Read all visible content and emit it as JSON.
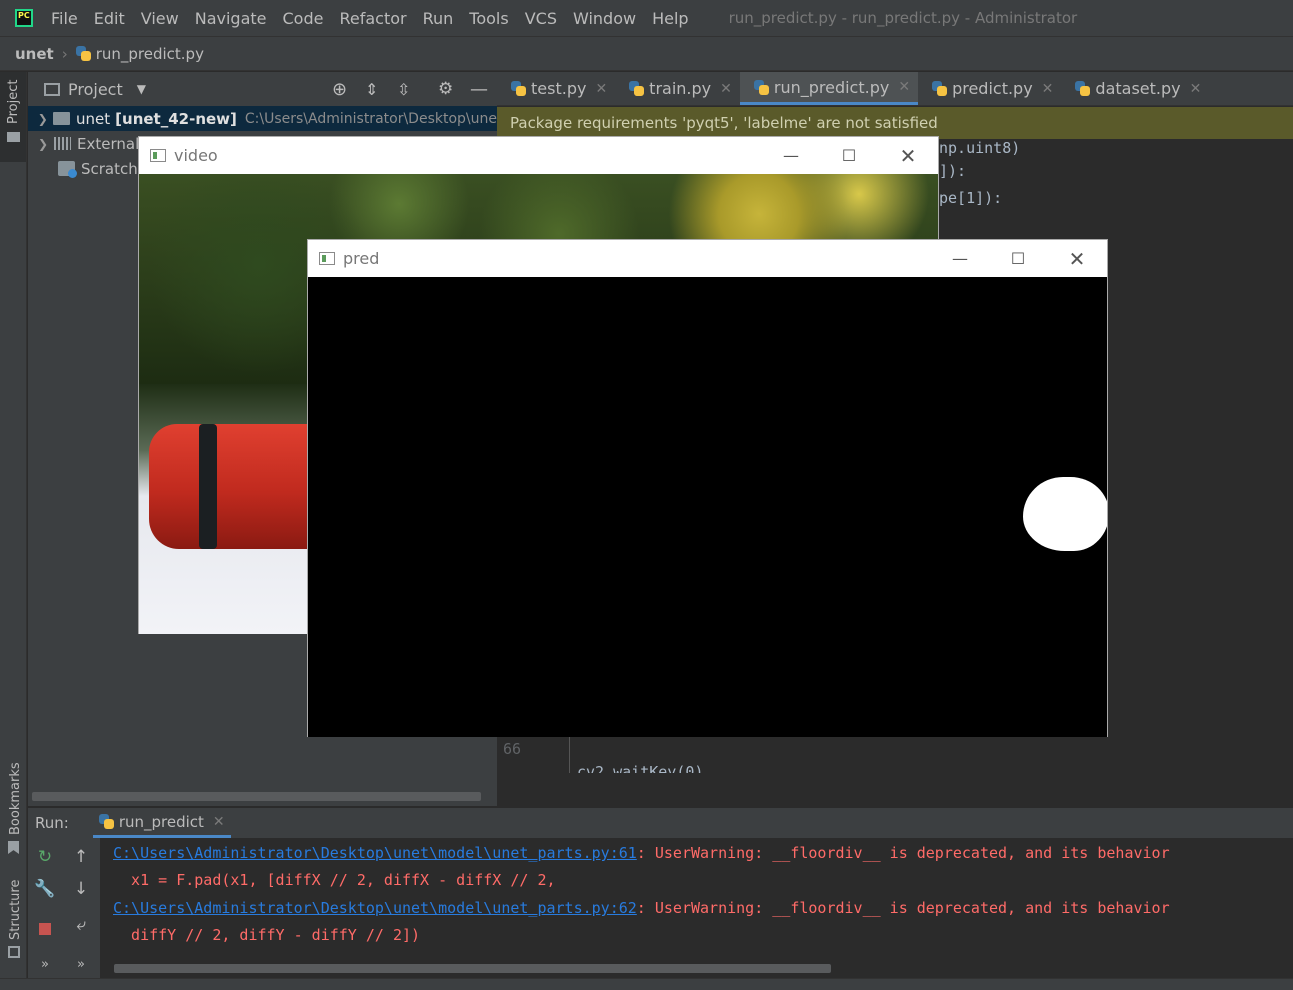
{
  "menubar": {
    "items": [
      "File",
      "Edit",
      "View",
      "Navigate",
      "Code",
      "Refactor",
      "Run",
      "Tools",
      "VCS",
      "Window",
      "Help"
    ],
    "title": "run_predict.py - run_predict.py - Administrator"
  },
  "breadcrumb": {
    "root": "unet",
    "file": "run_predict.py"
  },
  "left_strip": {
    "project": "Project",
    "bookmarks": "Bookmarks",
    "structure": "Structure"
  },
  "project_panel": {
    "title": "Project",
    "tree": [
      {
        "name": "unet",
        "bold": "[unet_42-new]",
        "path": "C:\\Users\\Administrator\\Desktop\\une"
      },
      {
        "name": "External"
      },
      {
        "name": "Scratche"
      }
    ]
  },
  "editor": {
    "tabs": [
      "test.py",
      "train.py",
      "run_predict.py",
      "predict.py",
      "dataset.py"
    ],
    "active_tab": "run_predict.py",
    "banner": "Package requirements 'pyqt5', 'labelme' are not satisfied",
    "code_fragments": [
      "np.uint8)",
      "]):",
      "pe[1]):"
    ],
    "line_number": "66",
    "partial_line": "cv2.waitKey(0)"
  },
  "video_window": {
    "title": "video"
  },
  "pred_window": {
    "title": "pred"
  },
  "run_panel": {
    "label": "Run:",
    "tab": "run_predict",
    "lines": [
      {
        "link": "C:\\Users\\Administrator\\Desktop\\unet\\model\\unet_parts.py:61",
        "text": ": UserWarning: __floordiv__ is deprecated, and its behavior"
      },
      {
        "text": "  x1 = F.pad(x1, [diffX // 2, diffX - diffX // 2,"
      },
      {
        "link": "C:\\Users\\Administrator\\Desktop\\unet\\model\\unet_parts.py:62",
        "text": ": UserWarning: __floordiv__ is deprecated, and its behavior"
      },
      {
        "text": "  diffY // 2, diffY - diffY // 2])"
      }
    ]
  },
  "colors": {
    "background": "#2b2b2b",
    "panel": "#3c3f41",
    "accent": "#4a88c7",
    "error": "#ff6b68",
    "link": "#287bde",
    "banner": "#5a5a2a"
  }
}
